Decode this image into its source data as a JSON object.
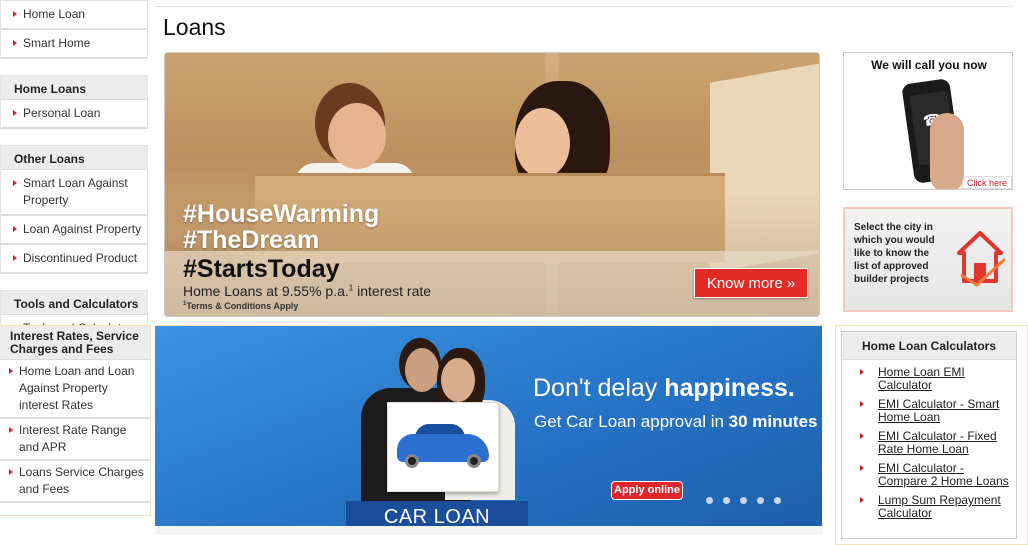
{
  "page": {
    "title": "Loans"
  },
  "sidebar": {
    "top_items": [
      {
        "label": "Home Loan"
      },
      {
        "label": "Smart Home"
      }
    ],
    "home_loans": {
      "heading": "Home Loans",
      "items": [
        {
          "label": "Personal Loan"
        }
      ]
    },
    "other_loans": {
      "heading": "Other Loans",
      "items": [
        {
          "label": "Smart Loan Against Property"
        },
        {
          "label": "Loan Against Property"
        },
        {
          "label": "Discontinued Product"
        }
      ]
    },
    "tools": {
      "heading": "Tools and Calculators",
      "items": [
        {
          "label": "Tools and Calculators"
        }
      ]
    },
    "rates": {
      "heading": "Interest Rates, Service Charges and Fees",
      "items": [
        {
          "label": "Home Loan and Loan Against Property interest Rates"
        },
        {
          "label": "Interest Rate Range and APR"
        },
        {
          "label": "Loans Service Charges and Fees"
        }
      ]
    }
  },
  "hero": {
    "line1": "#HouseWarming",
    "line2": "#TheDream",
    "line3": "#StartsToday",
    "subtitle_pre": "Home Loans at ",
    "subtitle_rate": "9.55% p.a.",
    "subtitle_sup": "1",
    "subtitle_post": " interest rate",
    "tc_sup": "1",
    "tc": "Terms & Conditions Apply",
    "cta": "Know more »"
  },
  "car_banner": {
    "headline_pre": "Don't delay ",
    "headline_bold": "happiness.",
    "subline_pre": "Get Car Loan approval in ",
    "subline_bold": "30 minutes",
    "label": "CAR LOAN",
    "apply": "Apply online",
    "slides": 5
  },
  "call_card": {
    "title": "We will call you now",
    "click": "Click here"
  },
  "city_card": {
    "text": "Select the city in which you would like to know the list of approved builder projects"
  },
  "calculators": {
    "heading": "Home Loan Calculators",
    "items": [
      {
        "label": "Home Loan EMI Calculator"
      },
      {
        "label": "EMI Calculator - Smart Home Loan"
      },
      {
        "label": "EMI Calculator - Fixed Rate Home Loan"
      },
      {
        "label": "EMI Calculator - Compare 2 Home Loans"
      },
      {
        "label": "Lump Sum Repayment Calculator"
      }
    ]
  },
  "colors": {
    "accent": "#d71e28",
    "banner_blue": "#2a7dd1",
    "cta_red": "#e02b27"
  },
  "icons": {
    "bullet": "red-triangle-bullet-icon",
    "phone": "phone-call-icon",
    "house": "house-checkmark-icon"
  }
}
